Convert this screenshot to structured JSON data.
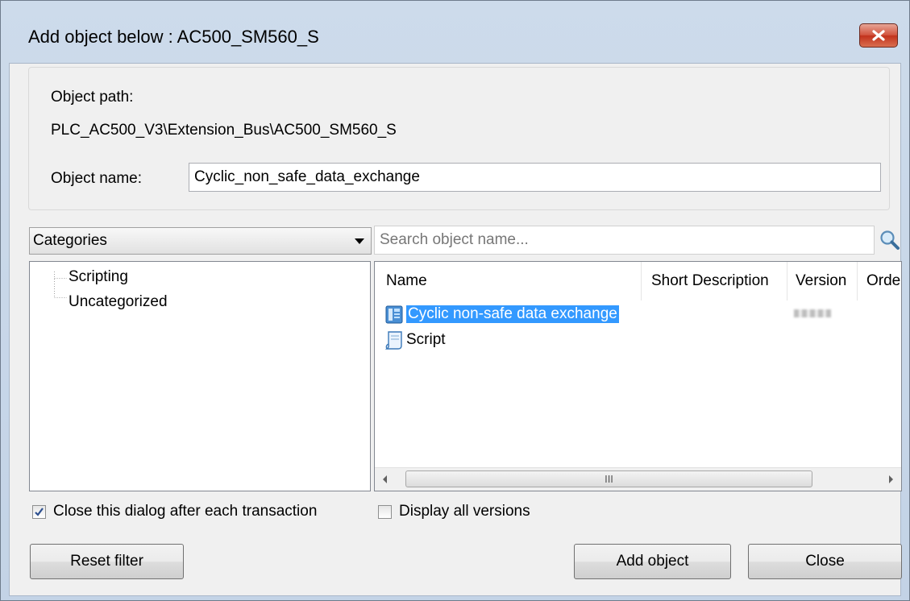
{
  "window": {
    "title": "Add object below : AC500_SM560_S"
  },
  "path_panel": {
    "object_path_label": "Object path:",
    "object_path_value": "PLC_AC500_V3\\Extension_Bus\\AC500_SM560_S",
    "object_name_label": "Object name:",
    "object_name_value": "Cyclic_non_safe_data_exchange"
  },
  "filter": {
    "category_selected": "Categories",
    "search_placeholder": "Search object name..."
  },
  "categories_tree": [
    "Scripting",
    "Uncategorized"
  ],
  "object_list": {
    "columns": [
      "Name",
      "Short Description",
      "Version",
      "Orde"
    ],
    "rows": [
      {
        "name": "Cyclic non-safe data exchange",
        "icon": "device-module-icon",
        "selected": true
      },
      {
        "name": "Script",
        "icon": "script-icon",
        "selected": false
      }
    ],
    "scrollbar_grip": "III"
  },
  "options": {
    "close_after_transaction": {
      "label": "Close this dialog after each transaction",
      "checked": true
    },
    "display_all_versions": {
      "label": "Display all versions",
      "checked": false
    }
  },
  "buttons": {
    "reset_filter": "Reset filter",
    "add_object": "Add object",
    "close": "Close"
  },
  "colors": {
    "frame": "#c9d8ea",
    "selection": "#3399ff",
    "close_button": "#c9442e"
  }
}
